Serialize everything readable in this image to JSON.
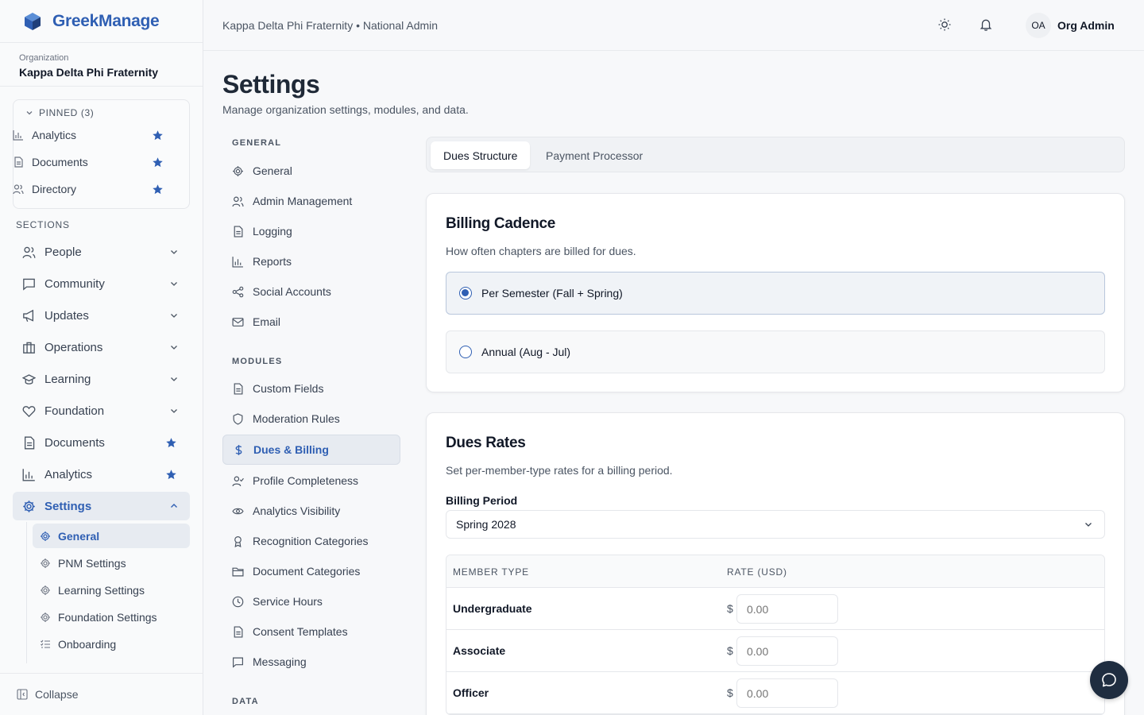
{
  "brand": {
    "name": "GreekManage"
  },
  "organization": {
    "label": "Organization",
    "name": "Kappa Delta Phi Fraternity"
  },
  "pinned": {
    "header": "PINNED (3)",
    "items": [
      {
        "label": "Analytics",
        "icon": "bar-chart-icon"
      },
      {
        "label": "Documents",
        "icon": "document-icon"
      },
      {
        "label": "Directory",
        "icon": "users-icon"
      }
    ]
  },
  "sections": {
    "label": "SECTIONS",
    "items": [
      {
        "label": "People",
        "icon": "users-icon"
      },
      {
        "label": "Community",
        "icon": "chat-icon"
      },
      {
        "label": "Updates",
        "icon": "megaphone-icon"
      },
      {
        "label": "Operations",
        "icon": "briefcase-icon"
      },
      {
        "label": "Learning",
        "icon": "graduation-cap-icon"
      },
      {
        "label": "Foundation",
        "icon": "heart-icon"
      },
      {
        "label": "Documents",
        "icon": "document-icon"
      },
      {
        "label": "Analytics",
        "icon": "bar-chart-icon"
      },
      {
        "label": "Settings",
        "icon": "gear-icon"
      }
    ],
    "settings_sub": [
      {
        "label": "General"
      },
      {
        "label": "PNM Settings"
      },
      {
        "label": "Learning Settings"
      },
      {
        "label": "Foundation Settings"
      },
      {
        "label": "Onboarding"
      }
    ]
  },
  "collapse_label": "Collapse",
  "header": {
    "breadcrumb": "Kappa Delta Phi Fraternity • National Admin",
    "avatar_initials": "OA",
    "user_name": "Org Admin"
  },
  "page": {
    "title": "Settings",
    "subtitle": "Manage organization settings, modules, and data."
  },
  "settings_nav": {
    "general_label": "GENERAL",
    "general_items": [
      "General",
      "Admin Management",
      "Logging",
      "Reports",
      "Social Accounts",
      "Email"
    ],
    "modules_label": "MODULES",
    "module_items": [
      "Custom Fields",
      "Moderation Rules",
      "Dues & Billing",
      "Profile Completeness",
      "Analytics Visibility",
      "Recognition Categories",
      "Document Categories",
      "Service Hours",
      "Consent Templates",
      "Messaging"
    ],
    "data_label": "DATA"
  },
  "tabs": [
    "Dues Structure",
    "Payment Processor"
  ],
  "billing_cadence": {
    "title": "Billing Cadence",
    "description": "How often chapters are billed for dues.",
    "options": [
      "Per Semester (Fall + Spring)",
      "Annual (Aug - Jul)"
    ],
    "selected": "Per Semester (Fall + Spring)"
  },
  "dues_rates": {
    "title": "Dues Rates",
    "description": "Set per-member-type rates for a billing period.",
    "period_label": "Billing Period",
    "period_value": "Spring 2028",
    "columns": [
      "MEMBER TYPE",
      "RATE (USD)"
    ],
    "currency_symbol": "$",
    "rows": [
      {
        "member_type": "Undergraduate",
        "rate_placeholder": "0.00"
      },
      {
        "member_type": "Associate",
        "rate_placeholder": "0.00"
      },
      {
        "member_type": "Officer",
        "rate_placeholder": "0.00"
      }
    ]
  },
  "colors": {
    "accent": "#2f5fb3",
    "fab": "#1f2d40"
  }
}
